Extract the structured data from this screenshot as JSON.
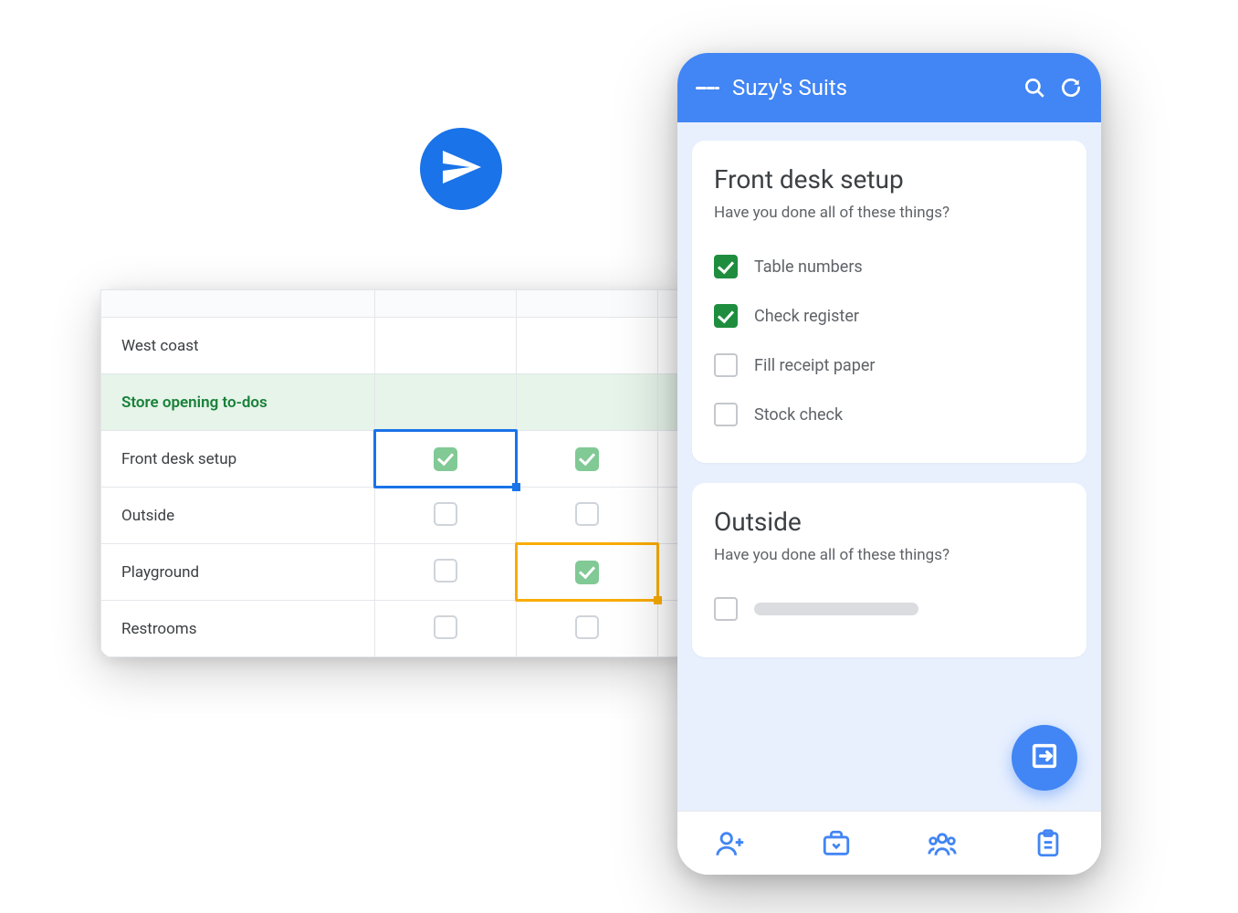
{
  "colors": {
    "primary": "#4285f4",
    "sheetGreen": "#188038",
    "checkGreen": "#81c995"
  },
  "sendBadge": {
    "icon": "paper-plane-icon"
  },
  "sheet": {
    "location": "West coast",
    "title": "Store opening to-dos",
    "rows": [
      {
        "label": "Front desk setup",
        "c1": true,
        "c2": true,
        "selection": "blue"
      },
      {
        "label": "Outside",
        "c1": false,
        "c2": false
      },
      {
        "label": "Playground",
        "c1": false,
        "c2": true,
        "selectionC2": "orange"
      },
      {
        "label": "Restrooms",
        "c1": false,
        "c2": false
      }
    ]
  },
  "phone": {
    "title": "Suzy's Suits",
    "cards": [
      {
        "title": "Front desk setup",
        "subtitle": "Have you done all of these things?",
        "tasks": [
          {
            "label": "Table numbers",
            "done": true
          },
          {
            "label": "Check register",
            "done": true
          },
          {
            "label": "Fill receipt paper",
            "done": false
          },
          {
            "label": "Stock check",
            "done": false
          }
        ]
      },
      {
        "title": "Outside",
        "subtitle": "Have you done all of these things?",
        "tasks": [
          {
            "placeholder": true,
            "done": false
          }
        ]
      }
    ],
    "fabIcon": "exit-to-app-icon",
    "nav": [
      "person-add-icon",
      "briefcase-icon",
      "group-icon",
      "clipboard-icon"
    ]
  }
}
